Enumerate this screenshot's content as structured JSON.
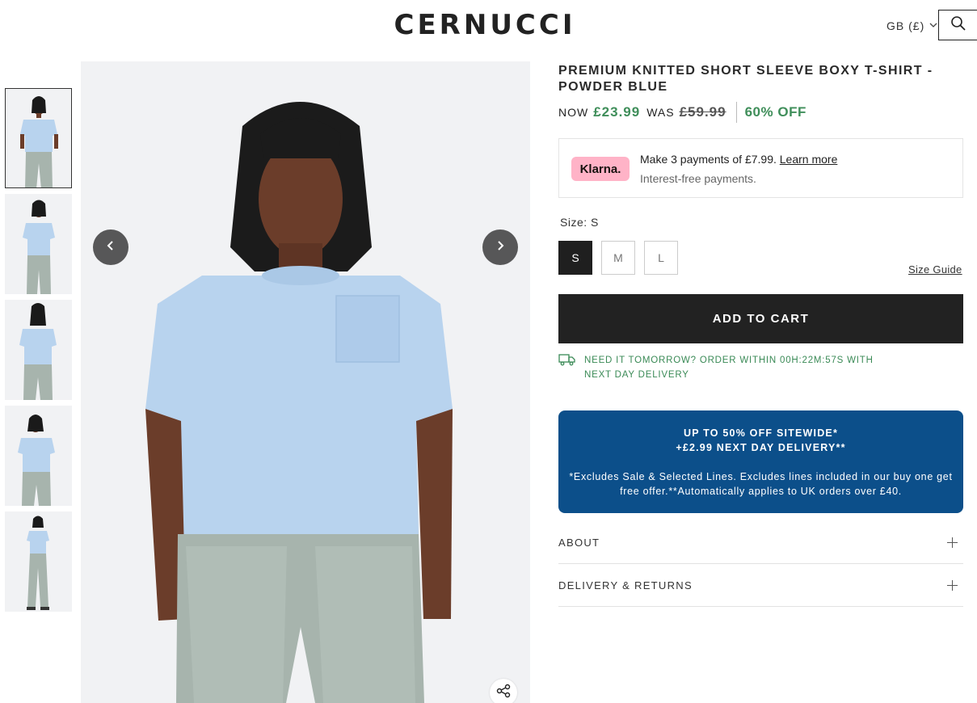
{
  "header": {
    "logo": "CERNUCCI",
    "region": "GB (£)",
    "search_icon": "search-icon"
  },
  "gallery": {
    "thumbnail_count": 5,
    "active_index": 0,
    "colors": {
      "shirt": "#b8d3ee",
      "jeans": "#a7b4ad",
      "skin": "#6b3d2a",
      "bg": "#f1f2f4"
    }
  },
  "product": {
    "title": "PREMIUM KNITTED SHORT SLEEVE BOXY T-SHIRT - POWDER BLUE",
    "now_label": "NOW",
    "now_price": "£23.99",
    "was_label": "WAS",
    "was_price": "£59.99",
    "discount": "60% OFF"
  },
  "klarna": {
    "badge": "Klarna.",
    "line1_prefix": "Make 3 payments of £7.99. ",
    "line1_link": "Learn more",
    "line2": "Interest-free payments."
  },
  "size": {
    "label": "Size: S",
    "options": [
      "S",
      "M",
      "L"
    ],
    "selected": "S",
    "guide": "Size Guide"
  },
  "add_to_cart": "ADD TO CART",
  "delivery_notice": "NEED IT TOMORROW? ORDER WITHIN 00H:22M:57S WITH NEXT DAY DELIVERY",
  "promo": {
    "line1": "UP TO 50% OFF SITEWIDE*",
    "line2": "+£2.99 NEXT DAY DELIVERY**",
    "fine_print": "*Excludes Sale & Selected Lines. Excludes lines included in our buy one get free offer.**Automatically applies to UK orders over £40."
  },
  "accordions": [
    "ABOUT",
    "DELIVERY & RETURNS"
  ]
}
